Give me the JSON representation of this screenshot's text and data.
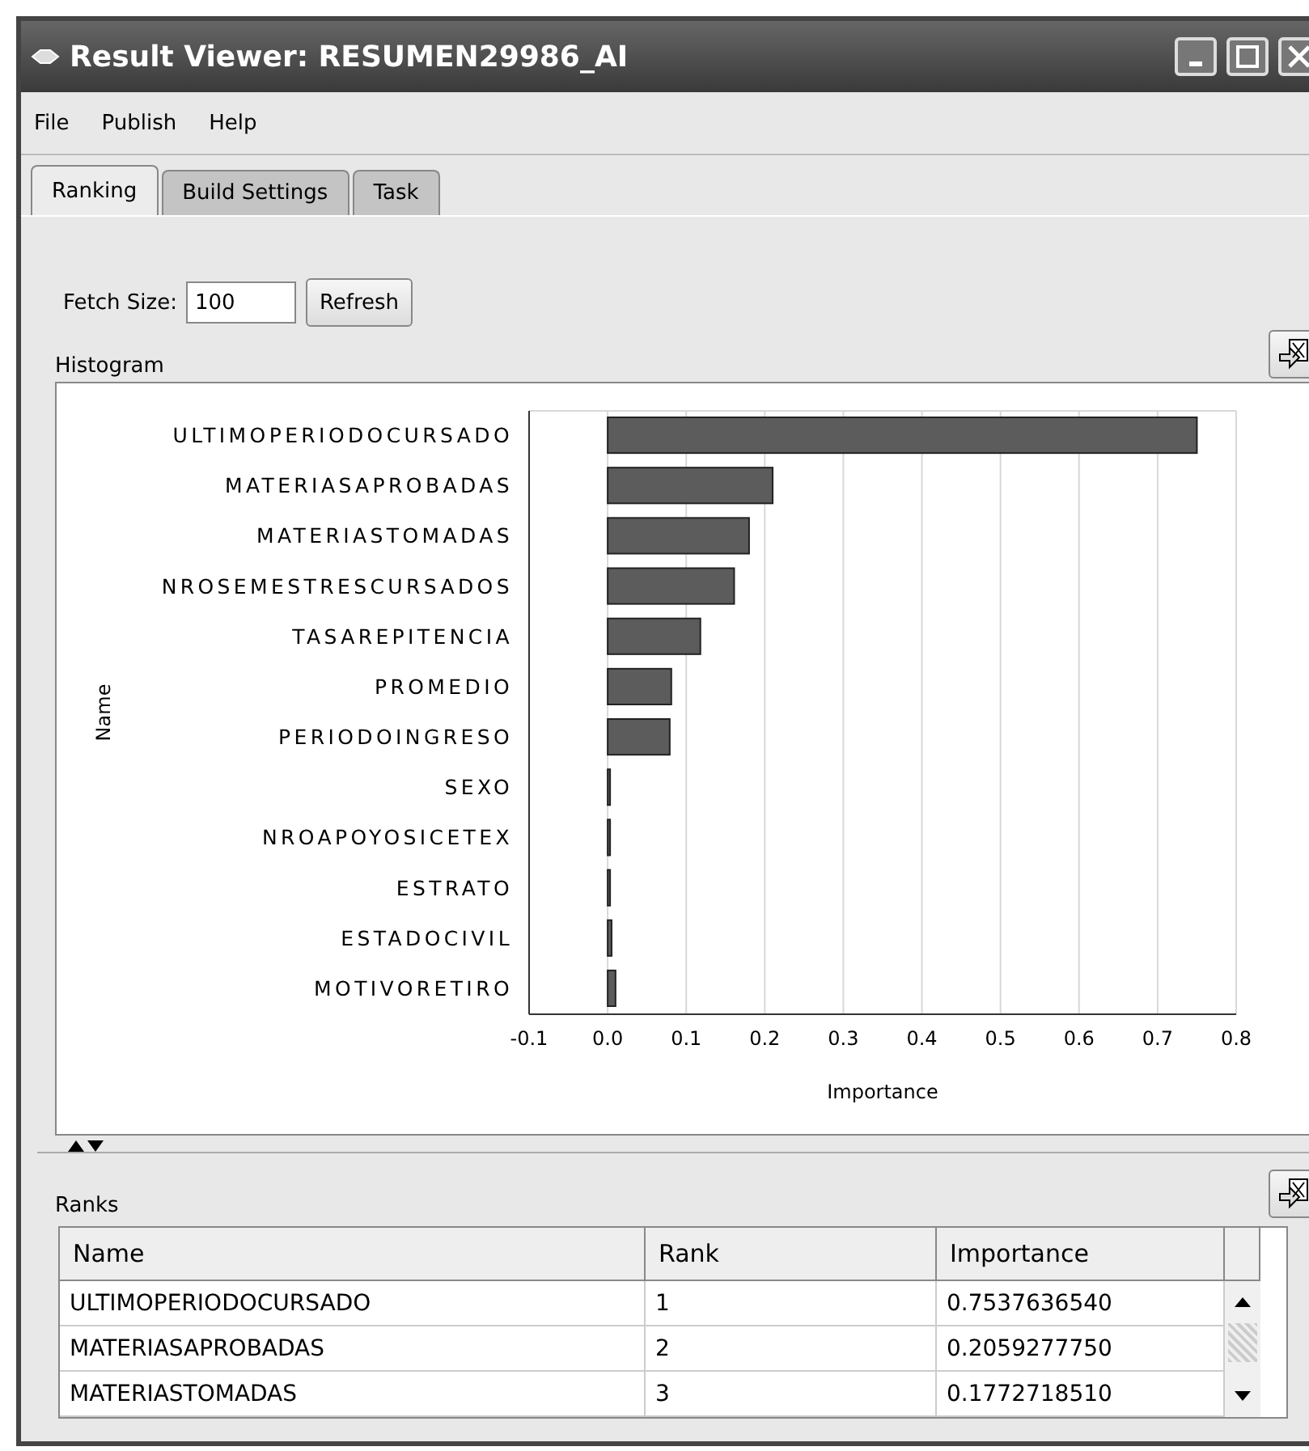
{
  "window": {
    "title": "Result Viewer: RESUMEN29986_AI"
  },
  "menu": [
    "File",
    "Publish",
    "Help"
  ],
  "tabs": [
    {
      "label": "Ranking",
      "selected": true
    },
    {
      "label": "Build Settings",
      "selected": false
    },
    {
      "label": "Task",
      "selected": false
    }
  ],
  "fetch": {
    "label": "Fetch Size:",
    "value": "100",
    "button": "Refresh"
  },
  "histogram": {
    "label": "Histogram",
    "chart_data": {
      "type": "bar",
      "orientation": "horizontal",
      "xlabel": "Importance",
      "ylabel": "Name",
      "categories": [
        "ULTIMOPERIODOCURSADO",
        "MATERIASAPROBADAS",
        "MATERIASTOMADAS",
        "NROSEMESTRESCURSADOS",
        "TASAREPITENCIA",
        "PROMEDIO",
        "PERIODOINGRESO",
        "SEXO",
        "NROAPOYOSICETEX",
        "ESTRATO",
        "ESTADOCIVIL",
        "MOTIVORETIRO"
      ],
      "grid": true,
      "values": [
        0.75,
        0.21,
        0.18,
        0.161,
        0.118,
        0.081,
        0.079,
        0.002,
        0.002,
        0.002,
        0.005,
        0.01
      ],
      "xlim": [
        -0.1,
        0.8
      ],
      "xticks": [
        {
          "value": -0.1,
          "label": "-0.1"
        },
        {
          "value": 0,
          "label": "0.0"
        },
        {
          "value": 0.1,
          "label": "0.1"
        },
        {
          "value": 0.2,
          "label": "0.2"
        },
        {
          "value": 0.3,
          "label": "0.3"
        },
        {
          "value": 0.4,
          "label": "0.4"
        },
        {
          "value": 0.5,
          "label": "0.5"
        },
        {
          "value": 0.6,
          "label": "0.6"
        },
        {
          "value": 0.7,
          "label": "0.7"
        },
        {
          "value": 0.8,
          "label": "0.8"
        }
      ]
    }
  },
  "ranks": {
    "label": "Ranks",
    "columns": [
      "Name",
      "Rank",
      "Importance"
    ],
    "rows": [
      [
        "ULTIMOPERIODOCURSADO",
        "1",
        "0.7537636540"
      ],
      [
        "MATERIASAPROBADAS",
        "2",
        "0.2059277750"
      ],
      [
        "MATERIASTOMADAS",
        "3",
        "0.1772718510"
      ]
    ]
  }
}
